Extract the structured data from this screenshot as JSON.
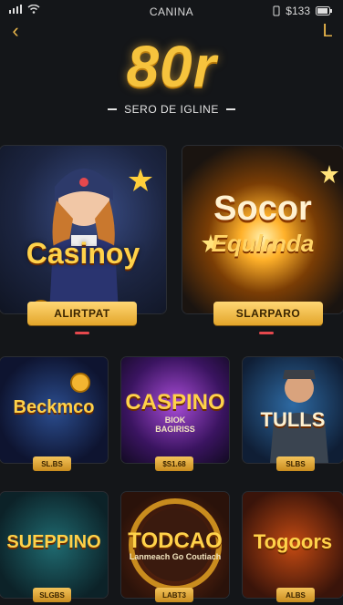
{
  "statusbar": {
    "carrier": "CANINA",
    "battery": "$133"
  },
  "nav": {
    "back_glyph": "‹",
    "right_glyph": "L"
  },
  "hero": {
    "title": "80r",
    "subtitle": "SERO DE IGLINE"
  },
  "featured": [
    {
      "title": "Casinoy",
      "button": "ALIRTPAT"
    },
    {
      "title": "Socor",
      "subtitle": "Equlrnda",
      "button": "SLARPARO"
    }
  ],
  "games": [
    {
      "title": "Beckmco",
      "sub": "",
      "button": "SL.BS"
    },
    {
      "title": "CASPINO",
      "sub": "BIOK\nBAGIRISS",
      "button": "$S1.68"
    },
    {
      "title": "TULLS",
      "sub": "",
      "button": "SLBS"
    },
    {
      "title": "SUEPPINO",
      "sub": "",
      "button": "SLGBS"
    },
    {
      "title": "TODCAO",
      "sub": "Lanmeach Go Coutiach",
      "button": "LABT3"
    },
    {
      "title": "Togoors",
      "sub": "",
      "button": "ALBS"
    }
  ],
  "colors": {
    "accent": "#e8b54a",
    "gold": "#f6c33d",
    "indicator": "#e5484d"
  },
  "icons": [
    "signal-icon",
    "wifi-icon",
    "back-icon",
    "battery-icon",
    "star-icon",
    "coin-icon"
  ]
}
